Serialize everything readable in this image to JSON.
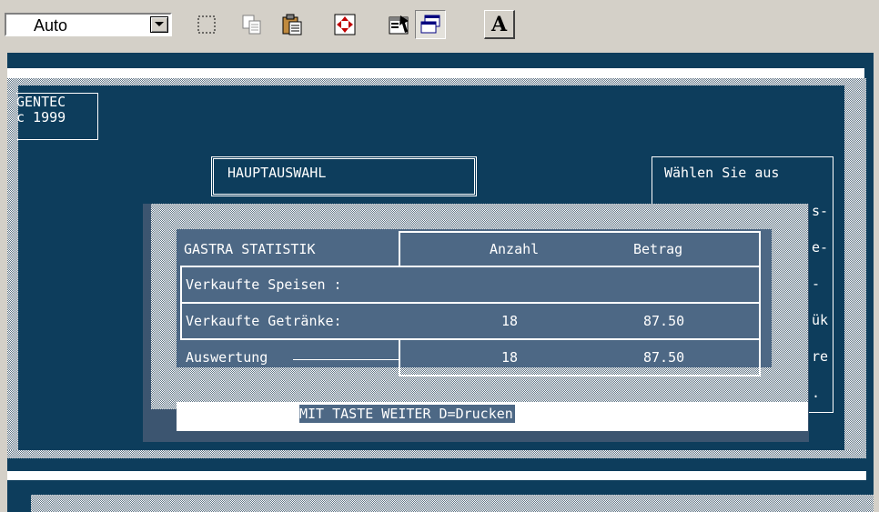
{
  "toolbar": {
    "font_size_value": "Auto",
    "buttons": [
      {
        "name": "mark-icon"
      },
      {
        "name": "copy-icon"
      },
      {
        "name": "paste-icon"
      },
      {
        "name": "fullscreen-icon"
      },
      {
        "name": "properties-icon"
      },
      {
        "name": "background-icon"
      },
      {
        "name": "font-icon",
        "glyph": "A"
      }
    ]
  },
  "console": {
    "gentec_line1": "GENTEC",
    "gentec_line2": "c 1999",
    "main_menu_title": "HAUPTAUSWAHL",
    "right_panel": {
      "title": "Wählen Sie aus",
      "fragments": [
        "s-",
        "e-",
        "-",
        "ük",
        "re",
        "."
      ]
    },
    "stats": {
      "title": "GASTRA STATISTIK",
      "col_count": "Anzahl",
      "col_amount": "Betrag",
      "rows": [
        {
          "label": "Verkaufte Speisen :",
          "count": "",
          "amount": ""
        },
        {
          "label": "Verkaufte Getränke:",
          "count": "18",
          "amount": "87.50"
        },
        {
          "label": "Auswertung",
          "count": "18",
          "amount": "87.50"
        }
      ],
      "footer": "MIT TASTE WEITER D=Drucken"
    }
  },
  "colors": {
    "console_bg": "#0d3d5c",
    "dialog_bg": "#4d6885",
    "text": "#ffffff",
    "toolbar_bg": "#d4d0c8"
  }
}
